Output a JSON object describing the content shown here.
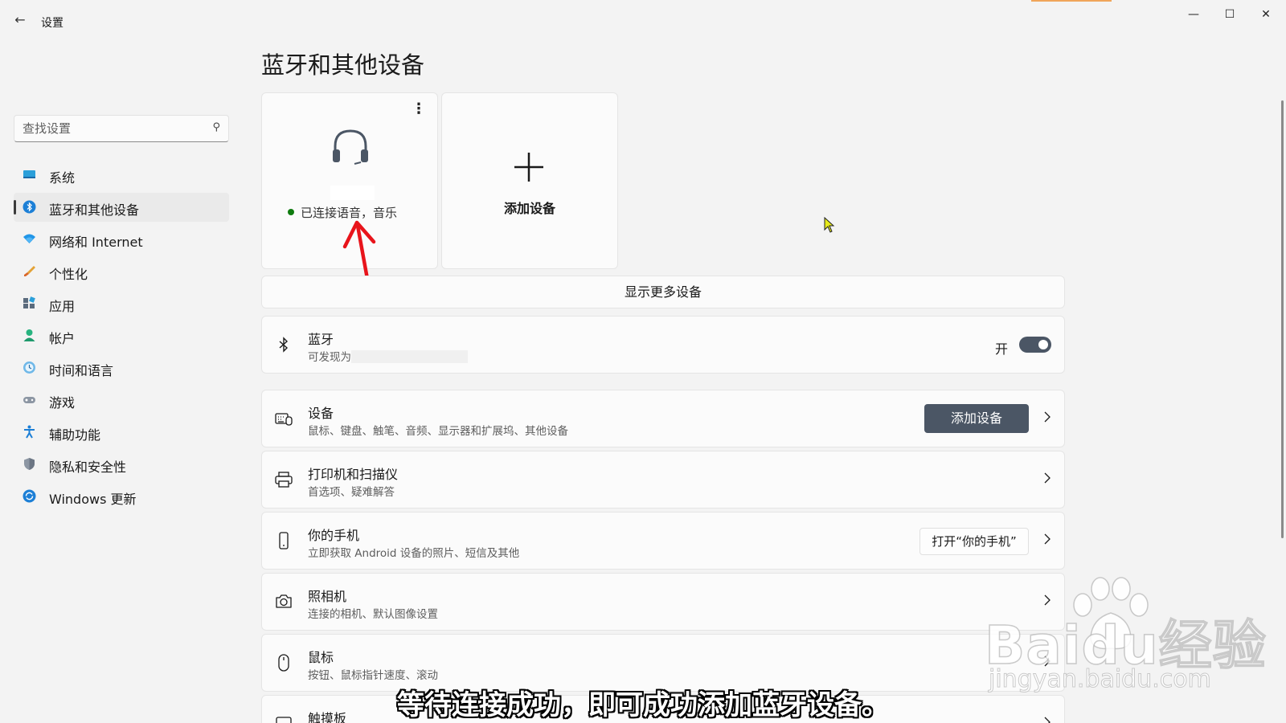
{
  "window": {
    "title": "设置",
    "back_icon": "back-arrow-icon",
    "minimize_icon": "minimize-icon",
    "maximize_icon": "maximize-icon",
    "close_icon": "close-icon"
  },
  "search": {
    "placeholder": "查找设置",
    "icon": "search-icon"
  },
  "sidebar": {
    "items": [
      {
        "label": "系统",
        "icon": "system-icon",
        "active": false
      },
      {
        "label": "蓝牙和其他设备",
        "icon": "bluetooth-icon",
        "active": true
      },
      {
        "label": "网络和 Internet",
        "icon": "wifi-icon",
        "active": false
      },
      {
        "label": "个性化",
        "icon": "brush-icon",
        "active": false
      },
      {
        "label": "应用",
        "icon": "apps-icon",
        "active": false
      },
      {
        "label": "帐户",
        "icon": "account-icon",
        "active": false
      },
      {
        "label": "时间和语言",
        "icon": "time-language-icon",
        "active": false
      },
      {
        "label": "游戏",
        "icon": "gamepad-icon",
        "active": false
      },
      {
        "label": "辅助功能",
        "icon": "accessibility-icon",
        "active": false
      },
      {
        "label": "隐私和安全性",
        "icon": "shield-icon",
        "active": false
      },
      {
        "label": "Windows 更新",
        "icon": "windows-update-icon",
        "active": false
      }
    ]
  },
  "main": {
    "title": "蓝牙和其他设备",
    "device_tile": {
      "icon": "headset-icon",
      "status": "已连接语音，音乐",
      "status_color": "#0f7b0f",
      "more_icon": "more-options-icon"
    },
    "add_tile": {
      "icon": "plus-icon",
      "label": "添加设备"
    },
    "show_more": "显示更多设备",
    "bluetooth": {
      "title": "蓝牙",
      "subtitle": "可发现为",
      "toggle_label": "开",
      "toggle_on": true,
      "icon": "bluetooth-icon"
    },
    "rows": {
      "devices": {
        "title": "设备",
        "subtitle": "鼠标、键盘、触笔、音频、显示器和扩展坞、其他设备",
        "button": "添加设备",
        "icon": "keyboard-mouse-icon"
      },
      "printers": {
        "title": "打印机和扫描仪",
        "subtitle": "首选项、疑难解答",
        "icon": "printer-icon"
      },
      "phone": {
        "title": "你的手机",
        "subtitle": "立即获取 Android 设备的照片、短信及其他",
        "button": "打开“你的手机”",
        "icon": "phone-icon"
      },
      "camera": {
        "title": "照相机",
        "subtitle": "连接的相机、默认图像设置",
        "icon": "camera-icon"
      },
      "mouse": {
        "title": "鼠标",
        "subtitle": "按钮、鼠标指针速度、滚动",
        "icon": "mouse-icon"
      },
      "touchpad": {
        "title": "触摸板",
        "icon": "touchpad-icon"
      }
    }
  },
  "overlay": {
    "caption": "等待连接成功，即可成功添加蓝牙设备。",
    "watermark_brand": "Baidu经验",
    "watermark_url": "jingyan.baidu.com"
  },
  "colors": {
    "accent_dark": "#4b5665",
    "background": "#f3f3f3",
    "card": "#fbfbfb",
    "annotation_arrow": "#e8141b",
    "connected": "#0f7b0f"
  }
}
